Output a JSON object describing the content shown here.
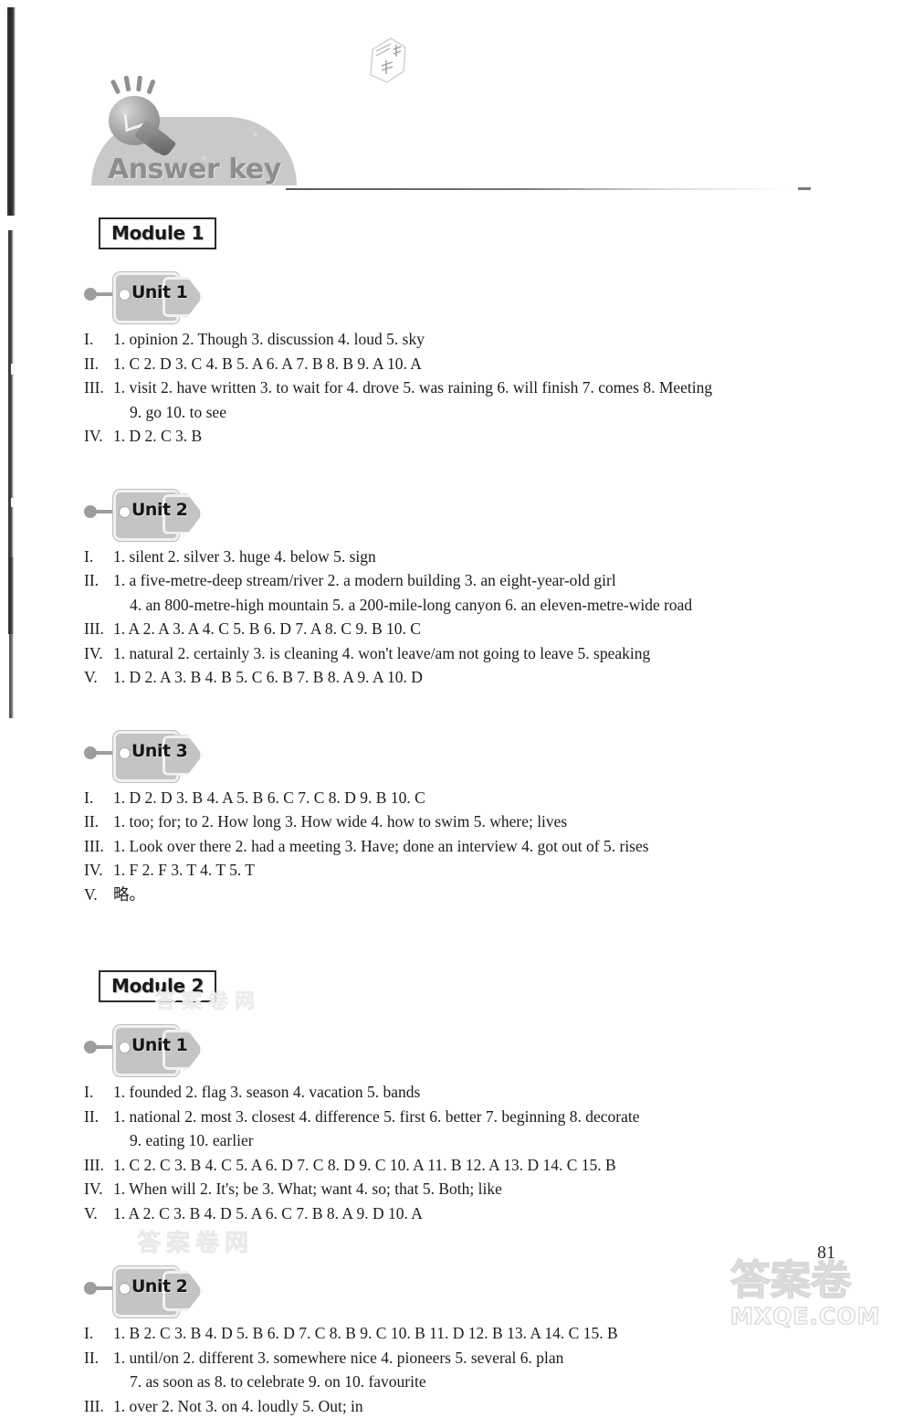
{
  "header": {
    "title": "Answer key",
    "bulb_icon": "lightbulb-icon",
    "doodle_icon": "handwritten-stamp-doodle"
  },
  "page_number": "81",
  "watermarks": {
    "brand_cn": "答案卷",
    "brand_url": "MXQE.COM",
    "faint_bottom": "答案卷网",
    "faint_mid": "答案卷网"
  },
  "modules": [
    {
      "label": "Module 1",
      "units": [
        {
          "label": "Unit 1",
          "lines": [
            {
              "rn": "I.",
              "cont": false,
              "body": "1. opinion   2. Though   3. discussion   4. loud   5. sky"
            },
            {
              "rn": "II.",
              "cont": false,
              "body": "1. C   2. D   3. C   4. B   5. A   6. A   7. B   8. B   9. A   10. A"
            },
            {
              "rn": "III.",
              "cont": false,
              "body": "1. visit   2. have written   3. to wait for   4. drove   5. was raining   6. will finish   7. comes   8. Meeting"
            },
            {
              "rn": "III.",
              "cont": true,
              "body": "9. go   10. to see"
            },
            {
              "rn": "IV.",
              "cont": false,
              "body": "1. D   2. C   3. B"
            }
          ]
        },
        {
          "label": "Unit 2",
          "lines": [
            {
              "rn": "I.",
              "cont": false,
              "body": "1. silent   2. silver   3. huge   4. below   5. sign"
            },
            {
              "rn": "II.",
              "cont": false,
              "body": "1. a five-metre-deep stream/river   2. a modern building   3. an eight-year-old girl"
            },
            {
              "rn": "II.",
              "cont": true,
              "body": "4. an 800-metre-high mountain   5. a 200-mile-long canyon   6. an eleven-metre-wide road"
            },
            {
              "rn": "III.",
              "cont": false,
              "body": "1. A   2. A   3. A   4. C   5. B   6. D   7. A   8. C   9. B   10. C"
            },
            {
              "rn": "IV.",
              "cont": false,
              "body": "1. natural   2. certainly   3. is cleaning   4. won't leave/am not going to leave   5. speaking"
            },
            {
              "rn": "V.",
              "cont": false,
              "body": "1. D   2. A   3. B   4. B   5. C   6. B   7. B   8. A   9. A   10. D"
            }
          ]
        },
        {
          "label": "Unit 3",
          "lines": [
            {
              "rn": "I.",
              "cont": false,
              "body": "1. D   2. D   3. B   4. A   5. B   6. C   7. C   8. D   9. B   10. C"
            },
            {
              "rn": "II.",
              "cont": false,
              "body": "1. too; for; to   2. How long   3. How wide   4. how to swim   5. where; lives"
            },
            {
              "rn": "III.",
              "cont": false,
              "body": "1. Look over there   2. had a meeting   3. Have; done an interview   4. got out of   5. rises"
            },
            {
              "rn": "IV.",
              "cont": false,
              "body": "1. F   2. F   3. T   4. T   5. T"
            },
            {
              "rn": "V.",
              "cont": false,
              "body": "略。"
            }
          ]
        }
      ]
    },
    {
      "label": "Module 2",
      "units": [
        {
          "label": "Unit 1",
          "lines": [
            {
              "rn": "I.",
              "cont": false,
              "body": "1. founded   2. flag   3. season   4. vacation   5. bands"
            },
            {
              "rn": "II.",
              "cont": false,
              "body": "1. national   2. most   3. closest   4. difference   5. first   6. better   7. beginning   8. decorate"
            },
            {
              "rn": "II.",
              "cont": true,
              "body": "9. eating   10. earlier"
            },
            {
              "rn": "III.",
              "cont": false,
              "body": "1. C   2. C   3. B   4. C   5. A   6. D   7. C   8. D   9. C   10. A   11. B   12. A   13. D   14. C   15. B"
            },
            {
              "rn": "IV.",
              "cont": false,
              "body": "1. When will   2. It's; be   3. What; want   4. so; that   5. Both; like"
            },
            {
              "rn": "V.",
              "cont": false,
              "body": "1. A   2. C   3. B   4. D   5. A   6. C   7. B   8. A   9. D   10. A"
            }
          ]
        },
        {
          "label": "Unit 2",
          "lines": [
            {
              "rn": "I.",
              "cont": false,
              "body": "1. B   2. C   3. B   4. D   5. B   6. D   7. C   8. B   9. C   10. B   11. D   12. B   13. A   14. C   15. B"
            },
            {
              "rn": "II.",
              "cont": false,
              "body": "1. until/on  2. different   3. somewhere nice   4. pioneers   5. several   6. plan"
            },
            {
              "rn": "II.",
              "cont": true,
              "body": "7. as soon as   8. to celebrate   9. on   10. favourite"
            },
            {
              "rn": "III.",
              "cont": false,
              "body": "1. over   2. Not   3. on   4. loudly   5. Out; in"
            }
          ]
        }
      ]
    }
  ]
}
